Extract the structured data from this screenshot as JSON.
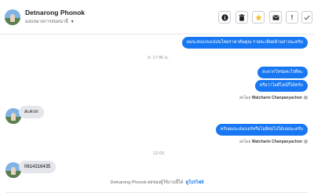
{
  "header": {
    "name": "Detnarong Phonok",
    "subtitle": "มอบหมายการสนทนานี้",
    "icons": [
      "info-icon",
      "trash-icon",
      "star-icon",
      "envelope-icon",
      "exclamation-icon",
      "check-icon"
    ]
  },
  "colors": {
    "outgoing_bubble": "#1877f2",
    "incoming_bubble": "#e4e6eb",
    "star": "#f7b928",
    "link": "#1877f2"
  },
  "messages": {
    "m1": "ผมจะส่งแบบแปปนใหม่ราคาต้นคุณ รายละเอียดด้านล่างนะครับ",
    "ts1": "ส. 17:45 น.",
    "m2": "สะดวกโทรมคะไรดีคะ",
    "m3": "หรือว่าไอดีไลน์ก็ได้ครับ",
    "sent1_prefix": "ส่งโดย",
    "sent1_name": "Watcharin Chanpanyachon",
    "m4": "สะดวก",
    "m5": "ครับผมจะส่งเบอร์หรือไอดีต่อไปได้เลยนะครับ",
    "sent2_prefix": "ส่งโดย",
    "sent2_name": "Watcharin Chanpanyachon",
    "ts2": "12:03",
    "m6": "0614316435"
  },
  "footer": {
    "text": "Detnarong Phonok ผลของผู้ใช้งานนี้ได้",
    "link": "ดูโปรไฟล์"
  }
}
